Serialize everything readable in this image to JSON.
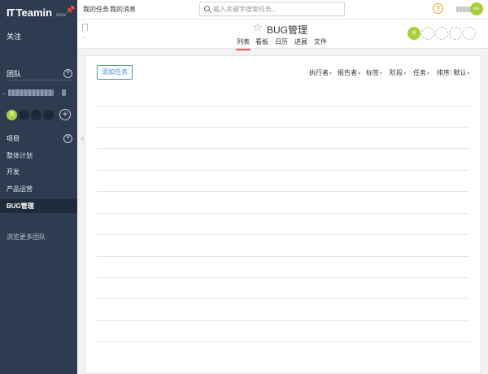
{
  "sidebar": {
    "logo_mark": "IT",
    "logo_name": "Teamin",
    "logo_beta": "beta",
    "follow": "关注",
    "team_section": "团队",
    "projects_section": "项目",
    "nav_items": [
      "整体计划",
      "开发",
      "产品运营",
      "BUG管理"
    ],
    "active_item": "BUG管理",
    "browse_more": "浏览更多团队",
    "avatar_label": "我"
  },
  "topbar": {
    "my_tasks": "我的任务",
    "my_messages": "我的消息",
    "search_placeholder": "输入关键字搜索任务...",
    "help": "?",
    "user_avatar_label": "me"
  },
  "project": {
    "title": "BUG管理",
    "tabs": [
      "列表",
      "看板",
      "日历",
      "进展",
      "文件"
    ],
    "active_tab": "列表",
    "member_label": "我"
  },
  "toolbar": {
    "add_task": "添加任务",
    "filters": [
      "执行者",
      "报告者",
      "标签",
      "阶段",
      "任务"
    ],
    "sort_label": "排序: 默认"
  },
  "colors": {
    "sidebar_bg": "#2f3b4f",
    "accent_green": "#a7cf3c",
    "tab_underline": "#e85c5c",
    "button_blue": "#4a8de8",
    "help_orange": "#f0a020"
  }
}
